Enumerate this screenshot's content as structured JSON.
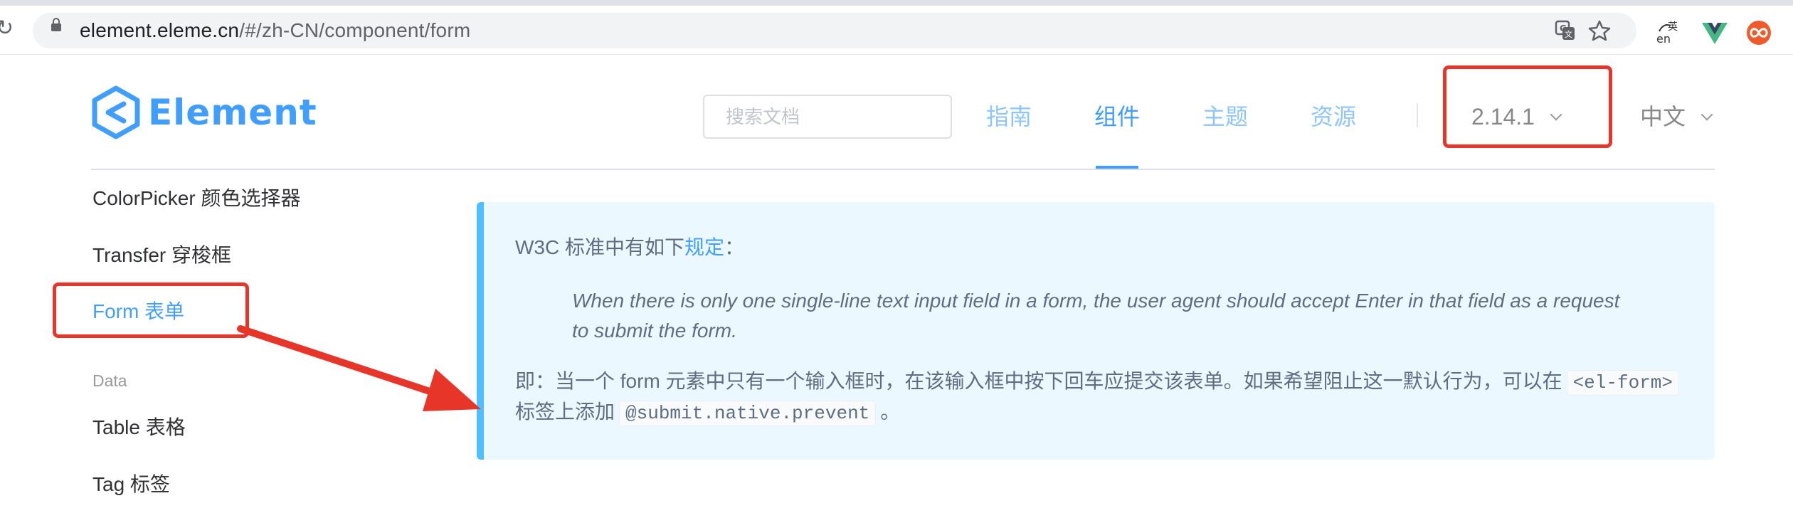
{
  "browser": {
    "url_host": "element.eleme.cn",
    "url_path": "/#/zh-CN/component/form"
  },
  "header": {
    "logo_text": "Element",
    "search_placeholder": "搜索文档",
    "nav": [
      {
        "label": "指南",
        "active": false
      },
      {
        "label": "组件",
        "active": true
      },
      {
        "label": "主题",
        "active": false
      },
      {
        "label": "资源",
        "active": false
      }
    ],
    "version": "2.14.1",
    "language": "中文"
  },
  "sidebar": {
    "items": [
      {
        "label": "ColorPicker 颜色选择器",
        "active": false
      },
      {
        "label": "Transfer 穿梭框",
        "active": false
      },
      {
        "label": "Form 表单",
        "active": true
      }
    ],
    "group_title": "Data",
    "data_items": [
      {
        "label": "Table 表格"
      },
      {
        "label": "Tag 标签"
      }
    ]
  },
  "tip": {
    "line1_prefix": "W3C 标准中有如下",
    "line1_link": "规定",
    "line1_suffix": "：",
    "quote_line1": "When there is only one single-line text input field in a form, the user agent should accept Enter in that field as a request",
    "quote_line2": "to submit the form.",
    "line3_text": "即：当一个 form 元素中只有一个输入框时，在该输入框中按下回车应提交该表单。如果希望阻止这一默认行为，可以在",
    "line3_code": "<el-form>",
    "line4_prefix": "标签上添加",
    "line4_code": "@submit.native.prevent",
    "line4_suffix": "。"
  },
  "colors": {
    "brand": "#409eff",
    "annotation_red": "#e8352a",
    "tip_background": "#ecf8ff",
    "tip_border": "#50bfff"
  }
}
